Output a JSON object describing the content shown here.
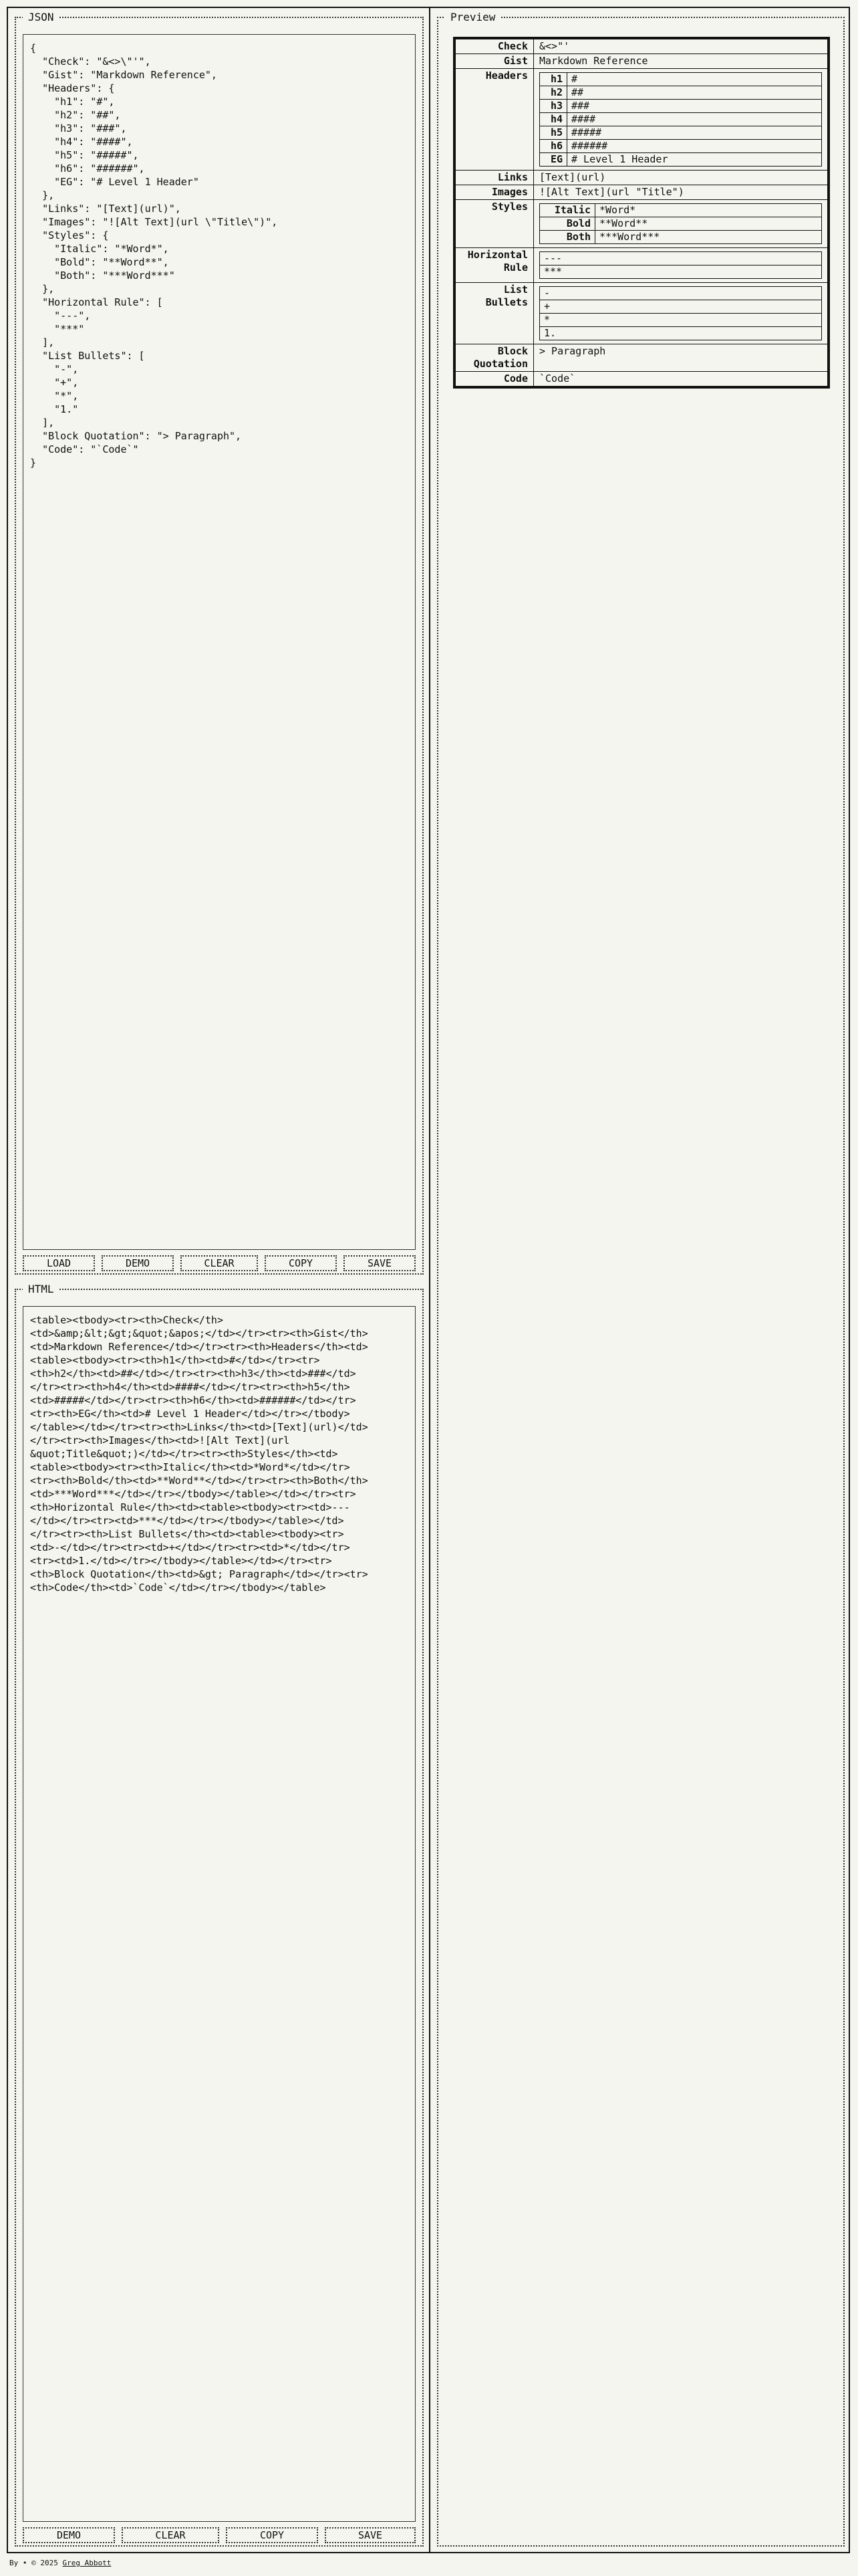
{
  "json_panel": {
    "legend": "JSON",
    "content": "{\n  \"Check\": \"&<>\\\"'\",\n  \"Gist\": \"Markdown Reference\",\n  \"Headers\": {\n    \"h1\": \"#\",\n    \"h2\": \"##\",\n    \"h3\": \"###\",\n    \"h4\": \"####\",\n    \"h5\": \"#####\",\n    \"h6\": \"######\",\n    \"EG\": \"# Level 1 Header\"\n  },\n  \"Links\": \"[Text](url)\",\n  \"Images\": \"![Alt Text](url \\\"Title\\\")\",\n  \"Styles\": {\n    \"Italic\": \"*Word*\",\n    \"Bold\": \"**Word**\",\n    \"Both\": \"***Word***\"\n  },\n  \"Horizontal Rule\": [\n    \"---\",\n    \"***\"\n  ],\n  \"List Bullets\": [\n    \"-\",\n    \"+\",\n    \"*\",\n    \"1.\"\n  ],\n  \"Block Quotation\": \"> Paragraph\",\n  \"Code\": \"`Code`\"\n}",
    "buttons": [
      "LOAD",
      "DEMO",
      "CLEAR",
      "COPY",
      "SAVE"
    ]
  },
  "html_panel": {
    "legend": "HTML",
    "content": "<table><tbody><tr><th>Check</th>\n<td>&amp;&lt;&gt;&quot;&apos;</td></tr><tr><th>Gist</th>\n<td>Markdown Reference</td></tr><tr><th>Headers</th><td>\n<table><tbody><tr><th>h1</th><td>#</td></tr><tr>\n<th>h2</th><td>##</td></tr><tr><th>h3</th><td>###</td>\n</tr><tr><th>h4</th><td>####</td></tr><tr><th>h5</th>\n<td>#####</td></tr><tr><th>h6</th><td>######</td></tr>\n<tr><th>EG</th><td># Level 1 Header</td></tr></tbody>\n</table></td></tr><tr><th>Links</th><td>[Text](url)</td>\n</tr><tr><th>Images</th><td>![Alt Text](url\n&quot;Title&quot;)</td></tr><tr><th>Styles</th><td>\n<table><tbody><tr><th>Italic</th><td>*Word*</td></tr>\n<tr><th>Bold</th><td>**Word**</td></tr><tr><th>Both</th>\n<td>***Word***</td></tr></tbody></table></td></tr><tr>\n<th>Horizontal Rule</th><td><table><tbody><tr><td>---\n</td></tr><tr><td>***</td></tr></tbody></table></td>\n</tr><tr><th>List Bullets</th><td><table><tbody><tr>\n<td>-</td></tr><tr><td>+</td></tr><tr><td>*</td></tr>\n<tr><td>1.</td></tr></tbody></table></td></tr><tr>\n<th>Block Quotation</th><td>&gt; Paragraph</td></tr><tr>\n<th>Code</th><td>`Code`</td></tr></tbody></table>",
    "buttons": [
      "DEMO",
      "CLEAR",
      "COPY",
      "SAVE"
    ]
  },
  "preview_panel": {
    "legend": "Preview",
    "check": {
      "label": "Check",
      "value": "&<>\"'"
    },
    "gist": {
      "label": "Gist",
      "value": "Markdown Reference"
    },
    "headers": {
      "label": "Headers",
      "rows": [
        {
          "k": "h1",
          "v": "#"
        },
        {
          "k": "h2",
          "v": "##"
        },
        {
          "k": "h3",
          "v": "###"
        },
        {
          "k": "h4",
          "v": "####"
        },
        {
          "k": "h5",
          "v": "#####"
        },
        {
          "k": "h6",
          "v": "######"
        },
        {
          "k": "EG",
          "v": "# Level 1 Header"
        }
      ]
    },
    "links": {
      "label": "Links",
      "value": "[Text](url)"
    },
    "images": {
      "label": "Images",
      "value": "![Alt Text](url \"Title\")"
    },
    "styles": {
      "label": "Styles",
      "rows": [
        {
          "k": "Italic",
          "v": "*Word*"
        },
        {
          "k": "Bold",
          "v": "**Word**"
        },
        {
          "k": "Both",
          "v": "***Word***"
        }
      ]
    },
    "hrule": {
      "label": "Horizontal Rule",
      "rows": [
        "---",
        "***"
      ]
    },
    "bullets": {
      "label": "List Bullets",
      "rows": [
        "-",
        "+",
        "*",
        "1."
      ]
    },
    "quote": {
      "label": "Block Quotation",
      "value": "> Paragraph"
    },
    "code": {
      "label": "Code",
      "value": "`Code`"
    }
  },
  "footer": {
    "prefix": "By • © 2025",
    "author": "Greg Abbott"
  }
}
